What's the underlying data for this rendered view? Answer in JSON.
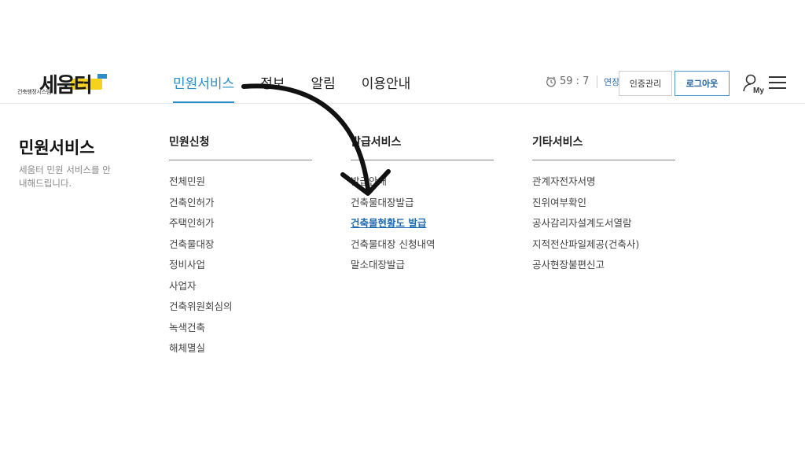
{
  "logo": {
    "name": "세움터",
    "subtitle": "건축행정시스템"
  },
  "gnb": [
    {
      "label": "민원서비스",
      "active": true
    },
    {
      "label": "정보",
      "active": false
    },
    {
      "label": "알림",
      "active": false
    },
    {
      "label": "이용안내",
      "active": false
    }
  ],
  "util": {
    "timer": "59 : 7",
    "extend": "연장",
    "cert_button": "인증관리",
    "logout_button": "로그아웃",
    "my_label": "My"
  },
  "mega": {
    "title": "민원서비스",
    "description": "세움터 민원 서비스를 안내해드립니다.",
    "columns": [
      {
        "title": "민원신청",
        "items": [
          "전체민원",
          "건축인허가",
          "주택인허가",
          "건축물대장",
          "정비사업",
          "사업자",
          "건축위원회심의",
          "녹색건축",
          "해체멸실"
        ]
      },
      {
        "title": "발급서비스",
        "items": [
          "발급안내",
          "건축물대장발급",
          "건축물현황도 발급",
          "건축물대장 신청내역",
          "말소대장발급"
        ]
      },
      {
        "title": "기타서비스",
        "items": [
          "관계자전자서명",
          "진위여부확인",
          "공사감리자설계도서열람",
          "지적전산파일제공(건축사)",
          "공사현장불편신고"
        ]
      }
    ]
  },
  "colors": {
    "accent": "#2a8fc9",
    "highlight": "#1e6ab3",
    "logo_yellow": "#f5d31c"
  }
}
